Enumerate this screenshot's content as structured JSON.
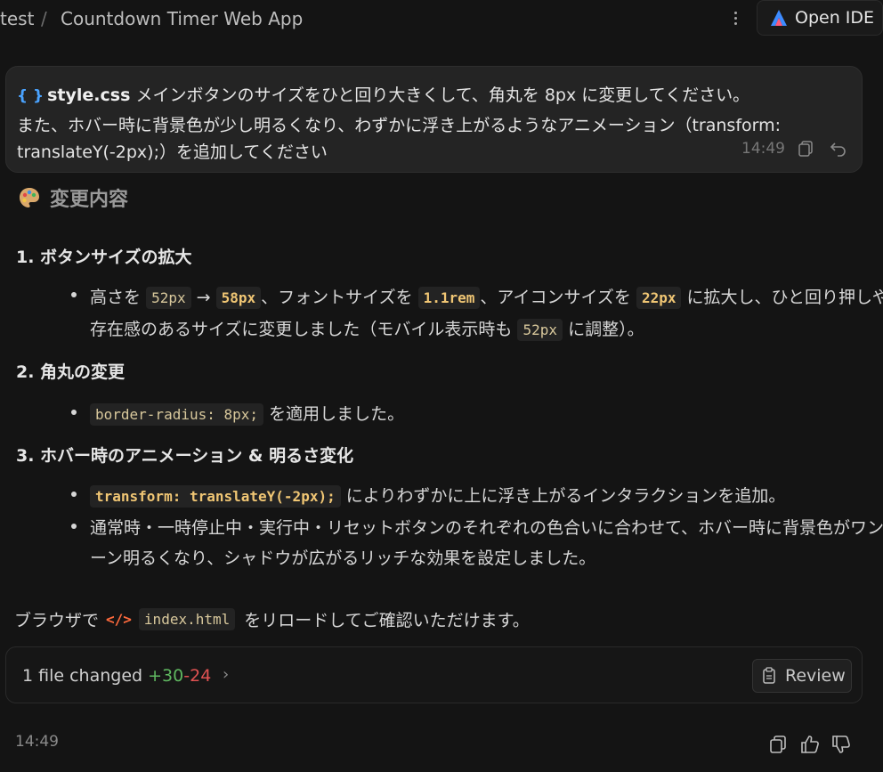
{
  "header": {
    "breadcrumb_root": "test",
    "breadcrumb_sep": "/",
    "title": "Countdown Timer Web App",
    "open_ide_label": "Open IDE"
  },
  "user_message": {
    "file": "style.css",
    "line1": "メインボタンのサイズをひと回り大きくして、角丸を 8px に変更してください。",
    "line2": "また、ホバー時に背景色が少し明るくなり、わずかに浮き上がるようなアニメーション（transform:",
    "line3": "translateY(-2px);）を追加してください",
    "time": "14:49"
  },
  "response": {
    "section_title": "変更内容",
    "item1_title": "1. ボタンサイズの拡大",
    "item1_b1_prefix": "高さを",
    "item1_b1_code1": "52px",
    "item1_b1_arrow": "→",
    "item1_b1_code2": "58px",
    "item1_b1_mid1": "、フォントサイズを",
    "item1_b1_code3": "1.1rem",
    "item1_b1_mid2": "、アイコンサイズを",
    "item1_b1_code4": "22px",
    "item1_b1_suffix": "に拡大し、ひと回り押しやすく",
    "item1_b1_line2_prefix": "存在感のあるサイズに変更しました（モバイル表示時も",
    "item1_b1_code5": "52px",
    "item1_b1_line2_suffix": "に調整）。",
    "item2_title": "2. 角丸の変更",
    "item2_b1_code": "border-radius: 8px;",
    "item2_b1_suffix": "を適用しました。",
    "item3_title": "3. ホバー時のアニメーション & 明るさ変化",
    "item3_b1_code": "transform: translateY(-2px);",
    "item3_b1_suffix": "によりわずかに上に浮き上がるインタラクションを追加。",
    "item3_b2_line1": "通常時・一時停止中・実行中・リセットボタンのそれぞれの色合いに合わせて、ホバー時に背景色がワント",
    "item3_b2_line2": "ーン明るくなり、シャドウが広がるリッチな効果を設定しました。",
    "footer_prefix": "ブラウザで",
    "footer_file": "index.html",
    "footer_suffix": "をリロードしてご確認いただけます。"
  },
  "changes": {
    "label": "1 file changed",
    "added": "+30",
    "removed": "-24",
    "review_label": "Review"
  },
  "bottom": {
    "time": "14:49"
  },
  "colors": {
    "background": "#141414",
    "accent_blue": "#4aa3ff",
    "added_green": "#5fb760",
    "removed_red": "#e05252",
    "html_icon": "#ff6a3d"
  }
}
